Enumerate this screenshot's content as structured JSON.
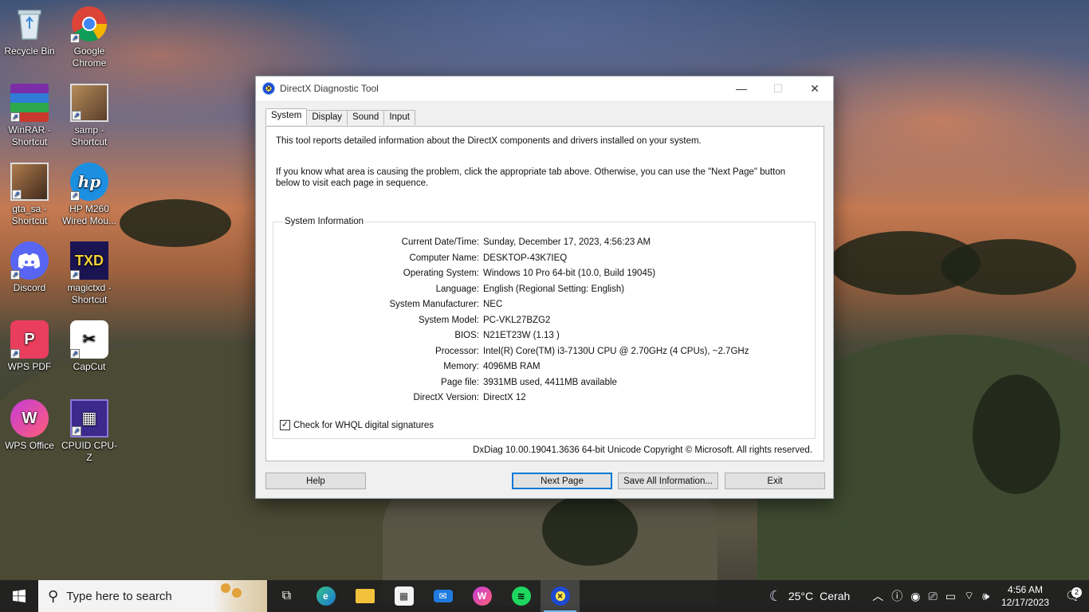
{
  "desktop": {
    "icons": [
      {
        "label": "Recycle Bin",
        "icon": "recycle-bin-icon"
      },
      {
        "label": "Google Chrome",
        "icon": "chrome-icon"
      },
      {
        "label": "WinRAR - Shortcut",
        "icon": "winrar-icon"
      },
      {
        "label": "samp - Shortcut",
        "icon": "samp-icon"
      },
      {
        "label": "gta_sa - Shortcut",
        "icon": "gta-sa-icon"
      },
      {
        "label": "HP M260 Wired Mou...",
        "icon": "hp-icon"
      },
      {
        "label": "Discord",
        "icon": "discord-icon"
      },
      {
        "label": "magictxd - Shortcut",
        "icon": "magictxd-icon",
        "glyph": "TXD"
      },
      {
        "label": "WPS PDF",
        "icon": "wps-pdf-icon"
      },
      {
        "label": "CapCut",
        "icon": "capcut-icon"
      },
      {
        "label": "WPS Office",
        "icon": "wps-office-icon"
      },
      {
        "label": "CPUID CPU-Z",
        "icon": "cpuz-icon"
      }
    ]
  },
  "window": {
    "title": "DirectX Diagnostic Tool",
    "tabs": [
      "System",
      "Display",
      "Sound",
      "Input"
    ],
    "active_tab": "System",
    "intro1": "This tool reports detailed information about the DirectX components and drivers installed on your system.",
    "intro2": "If you know what area is causing the problem, click the appropriate tab above.  Otherwise, you can use the \"Next Page\" button below to visit each page in sequence.",
    "group_title": "System Information",
    "rows": [
      {
        "label": "Current Date/Time:",
        "value": "Sunday, December 17, 2023, 4:56:23 AM"
      },
      {
        "label": "Computer Name:",
        "value": "DESKTOP-43K7IEQ"
      },
      {
        "label": "Operating System:",
        "value": "Windows 10 Pro 64-bit (10.0, Build 19045)"
      },
      {
        "label": "Language:",
        "value": "English (Regional Setting: English)"
      },
      {
        "label": "System Manufacturer:",
        "value": "NEC"
      },
      {
        "label": "System Model:",
        "value": "PC-VKL27BZG2"
      },
      {
        "label": "BIOS:",
        "value": "N21ET23W (1.13 )"
      },
      {
        "label": "Processor:",
        "value": "Intel(R) Core(TM) i3-7130U CPU @ 2.70GHz (4 CPUs), ~2.7GHz"
      },
      {
        "label": "Memory:",
        "value": "4096MB RAM"
      },
      {
        "label": "Page file:",
        "value": "3931MB used, 4411MB available"
      },
      {
        "label": "DirectX Version:",
        "value": "DirectX 12"
      }
    ],
    "whql_label": "Check for WHQL digital signatures",
    "whql_checked": true,
    "footer": "DxDiag 10.00.19041.3636 64-bit Unicode  Copyright © Microsoft. All rights reserved.",
    "buttons": {
      "help": "Help",
      "next": "Next Page",
      "save": "Save All Information...",
      "exit": "Exit"
    }
  },
  "taskbar": {
    "search_placeholder": "Type here to search",
    "apps": [
      "task-view-icon",
      "edge-icon",
      "file-explorer-icon",
      "microsoft-store-icon",
      "mail-icon",
      "wps-office-icon",
      "spotify-icon",
      "dxdiag-icon"
    ],
    "weather_temp": "25°C",
    "weather_desc": "Cerah",
    "time": "4:56 AM",
    "date": "12/17/2023",
    "notification_count": "2"
  }
}
